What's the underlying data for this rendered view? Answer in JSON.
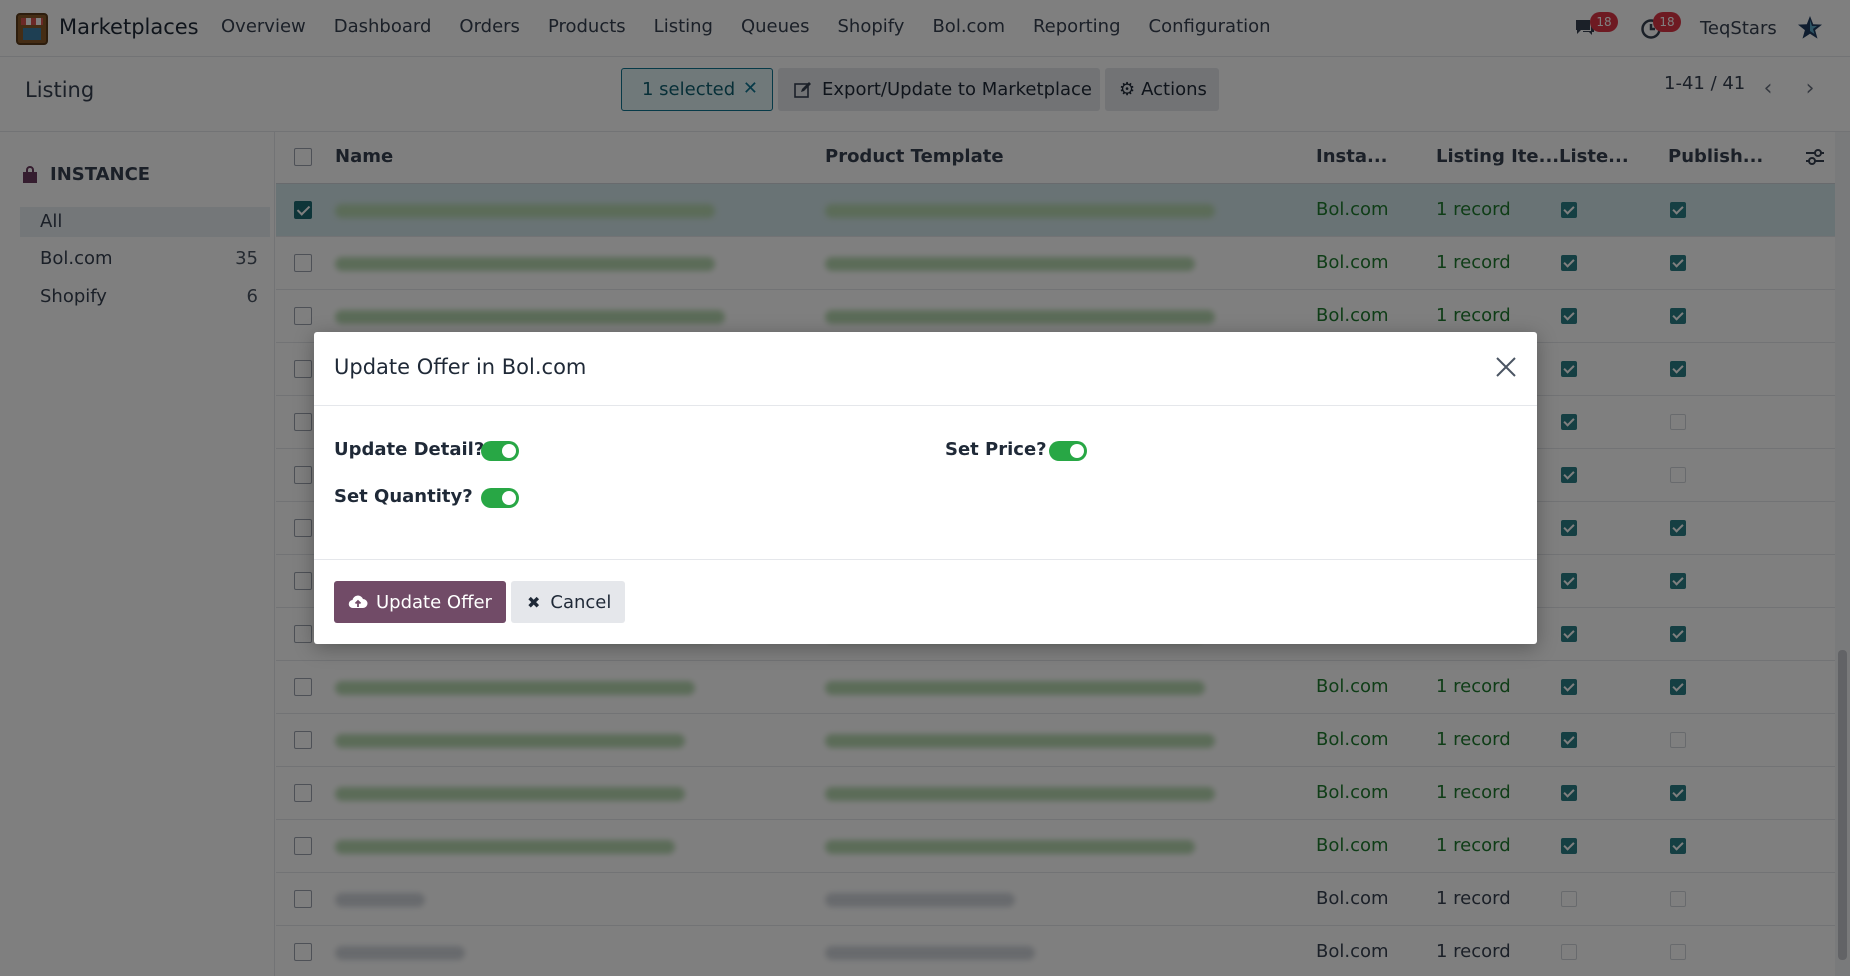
{
  "app": {
    "name": "Marketplaces"
  },
  "menu": [
    "Overview",
    "Dashboard",
    "Orders",
    "Products",
    "Listing",
    "Queues",
    "Shopify",
    "Bol.com",
    "Reporting",
    "Configuration"
  ],
  "systray": {
    "chat_count": "18",
    "activity_count": "18",
    "company": "TeqStars"
  },
  "control_panel": {
    "title": "Listing",
    "selected_label": "1 selected",
    "export_label": "Export/Update to Marketplace",
    "actions_label": "Actions",
    "pager": "1-41 / 41"
  },
  "sidebar": {
    "heading": "INSTANCE",
    "items": [
      {
        "label": "All",
        "count": ""
      },
      {
        "label": "Bol.com",
        "count": "35"
      },
      {
        "label": "Shopify",
        "count": "6"
      }
    ]
  },
  "table": {
    "columns": [
      "Name",
      "Product Template",
      "Insta...",
      "Listing Ite...",
      "Liste...",
      "Publish..."
    ],
    "rows": [
      {
        "instance": "Bol.com",
        "items": "1 record",
        "listed": true,
        "published": true,
        "selected": true,
        "green": true
      },
      {
        "instance": "Bol.com",
        "items": "1 record",
        "listed": true,
        "published": true,
        "selected": false,
        "green": true
      },
      {
        "instance": "Bol.com",
        "items": "1 record",
        "listed": true,
        "published": true,
        "selected": false,
        "green": true
      },
      {
        "instance": "",
        "items": "",
        "listed": true,
        "published": true,
        "selected": false,
        "green": true
      },
      {
        "instance": "",
        "items": "",
        "listed": true,
        "published": false,
        "selected": false,
        "green": true
      },
      {
        "instance": "",
        "items": "",
        "listed": true,
        "published": false,
        "selected": false,
        "green": true
      },
      {
        "instance": "",
        "items": "",
        "listed": true,
        "published": true,
        "selected": false,
        "green": true
      },
      {
        "instance": "",
        "items": "",
        "listed": true,
        "published": true,
        "selected": false,
        "green": true
      },
      {
        "instance": "",
        "items": "",
        "listed": true,
        "published": true,
        "selected": false,
        "green": true
      },
      {
        "instance": "Bol.com",
        "items": "1 record",
        "listed": true,
        "published": true,
        "selected": false,
        "green": true
      },
      {
        "instance": "Bol.com",
        "items": "1 record",
        "listed": true,
        "published": false,
        "selected": false,
        "green": true
      },
      {
        "instance": "Bol.com",
        "items": "1 record",
        "listed": true,
        "published": true,
        "selected": false,
        "green": true
      },
      {
        "instance": "Bol.com",
        "items": "1 record",
        "listed": true,
        "published": true,
        "selected": false,
        "green": true
      },
      {
        "instance": "Bol.com",
        "items": "1 record",
        "listed": false,
        "published": false,
        "selected": false,
        "green": false
      },
      {
        "instance": "Bol.com",
        "items": "1 record",
        "listed": false,
        "published": false,
        "selected": false,
        "green": false
      }
    ]
  },
  "modal": {
    "title": "Update Offer in Bol.com",
    "fields": {
      "update_detail": {
        "label": "Update Detail?",
        "value": true
      },
      "set_price": {
        "label": "Set Price?",
        "value": true
      },
      "set_quantity": {
        "label": "Set Quantity?",
        "value": true
      }
    },
    "primary_label": "Update Offer",
    "cancel_label": "Cancel"
  },
  "colors": {
    "accent": "#714b67",
    "teal": "#1d6a73",
    "toggle": "#28a745",
    "link_green": "#1e7a2e"
  }
}
